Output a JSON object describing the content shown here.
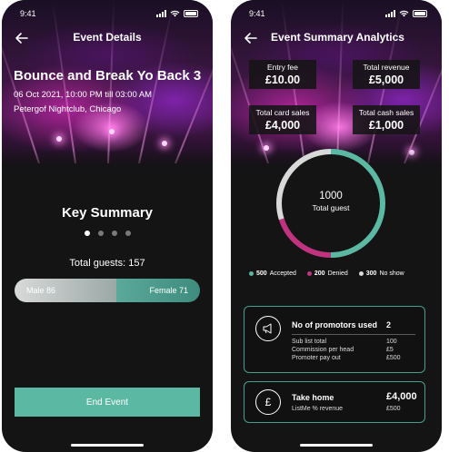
{
  "status": {
    "time": "9:41"
  },
  "left": {
    "nav_title": "Event Details",
    "event_title": "Bounce and Break Yo Back 3",
    "event_datetime": "06 Oct 2021, 10:00 PM till 03:00 AM",
    "event_venue": "Petergof Nightclub, Chicago",
    "section_title": "Key Summary",
    "pager": {
      "count": 4,
      "active": 1
    },
    "total_guests": "Total guests: 157",
    "male_label": "Male 86",
    "female_label": "Female 71",
    "gender_split": {
      "male": 86,
      "female": 71
    },
    "end_button": "End Event"
  },
  "right": {
    "nav_title": "Event Summary Analytics",
    "stats": [
      {
        "key": "Entry fee",
        "value": "£10.00"
      },
      {
        "key": "Total revenue",
        "value": "£5,000"
      },
      {
        "key": "Total card sales",
        "value": "£4,000"
      },
      {
        "key": "Total cash sales",
        "value": "£1,000"
      }
    ],
    "donut": {
      "total": "1000",
      "label": "Total guest",
      "segments": [
        {
          "name": "Accepted",
          "value": 500,
          "color": "#5bb8a2"
        },
        {
          "name": "Denied",
          "value": 200,
          "color": "#c0347f"
        },
        {
          "name": "No show",
          "value": 300,
          "color": "#d9d9d9"
        }
      ]
    },
    "legend": [
      {
        "count": "500",
        "label": "Accepted",
        "color": "#5bb8a2"
      },
      {
        "count": "200",
        "label": "Denied",
        "color": "#c0347f"
      },
      {
        "count": "300",
        "label": "No show",
        "color": "#d9d9d9"
      }
    ],
    "promotors": {
      "title": "No of promotors used",
      "count": "2",
      "rows": [
        {
          "label": "Sub list total",
          "value": "100"
        },
        {
          "label": "Commission per head",
          "value": "£5"
        },
        {
          "label": "Promoter pay out",
          "value": "£500"
        }
      ]
    },
    "takehome": {
      "symbol": "£",
      "title": "Take home",
      "value": "£4,000",
      "row_label": "ListMe % revenue",
      "row_value": "£500"
    }
  },
  "colors": {
    "accent": "#5bb8a2",
    "denied": "#c0347f",
    "noshow": "#d9d9d9",
    "background": "#141414"
  }
}
